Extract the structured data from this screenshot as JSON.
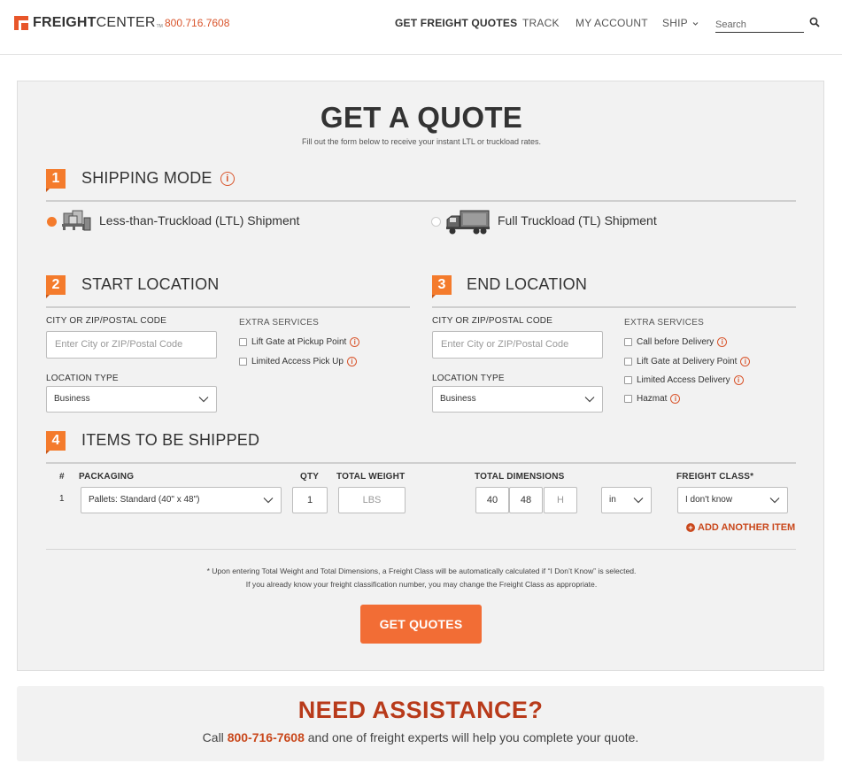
{
  "header": {
    "logo_bold": "FREIGHT",
    "logo_rest": "CENTER",
    "logo_tm": "TM",
    "phone": "800.716.7608",
    "nav": [
      {
        "label": "GET FREIGHT QUOTES",
        "active": true
      },
      {
        "label": "TRACK",
        "active": false
      },
      {
        "label": "MY ACCOUNT",
        "active": false
      },
      {
        "label": "SHIP",
        "active": false
      }
    ],
    "search_placeholder": "Search"
  },
  "quote": {
    "title": "GET A QUOTE",
    "subtitle": "Fill out the form below to receive your instant LTL or truckload rates.",
    "shipping_mode": {
      "number": "1",
      "title": "SHIPPING MODE",
      "options": [
        {
          "label": "Less-than-Truckload (LTL) Shipment",
          "selected": true
        },
        {
          "label": "Full Truckload (TL) Shipment",
          "selected": false
        }
      ]
    },
    "start": {
      "number": "2",
      "title": "START LOCATION",
      "city_label": "CITY OR ZIP/POSTAL CODE",
      "city_placeholder": "Enter City or ZIP/Postal Code",
      "location_type_label": "LOCATION TYPE",
      "location_type_value": "Business",
      "extra_label": "EXTRA SERVICES",
      "extras": [
        "Lift Gate at Pickup Point",
        "Limited Access Pick Up"
      ]
    },
    "end": {
      "number": "3",
      "title": "END LOCATION",
      "city_label": "CITY OR ZIP/POSTAL CODE",
      "city_placeholder": "Enter City or ZIP/Postal Code",
      "location_type_label": "LOCATION TYPE",
      "location_type_value": "Business",
      "extra_label": "EXTRA SERVICES",
      "extras": [
        "Call before Delivery",
        "Lift Gate at Delivery Point",
        "Limited Access Delivery",
        "Hazmat"
      ]
    },
    "items": {
      "number": "4",
      "title": "ITEMS TO BE SHIPPED",
      "headers": {
        "num": "#",
        "packaging": "PACKAGING",
        "qty": "QTY",
        "weight": "TOTAL WEIGHT",
        "dims": "TOTAL DIMENSIONS",
        "freight_class": "FREIGHT CLASS*"
      },
      "row": {
        "num": "1",
        "packaging": "Pallets: Standard (40\" x 48\")",
        "qty": "1",
        "weight_placeholder": "LBS",
        "length": "40",
        "width": "48",
        "height_placeholder": "H",
        "unit": "in",
        "freight_class": "I don't know"
      },
      "add_label": "ADD ANOTHER ITEM",
      "add_icon": "+"
    },
    "note_line1": "* Upon entering Total Weight and Total Dimensions, a Freight Class will be automatically calculated if “I Don’t Know” is selected.",
    "note_line2": "If you already know your freight classification number, you may change the Freight Class as appropriate.",
    "submit_label": "GET QUOTES",
    "info_glyph": "i"
  },
  "assistance": {
    "title": "NEED ASSISTANCE?",
    "text_before": "Call ",
    "phone": "800-716-7608",
    "text_after": " and one of freight experts will help you complete your quote."
  },
  "colors": {
    "accent": "#f47b2c",
    "accent_dark": "#c9481c",
    "assist_title": "#b83a1a",
    "card_bg": "#f2f2f2"
  }
}
